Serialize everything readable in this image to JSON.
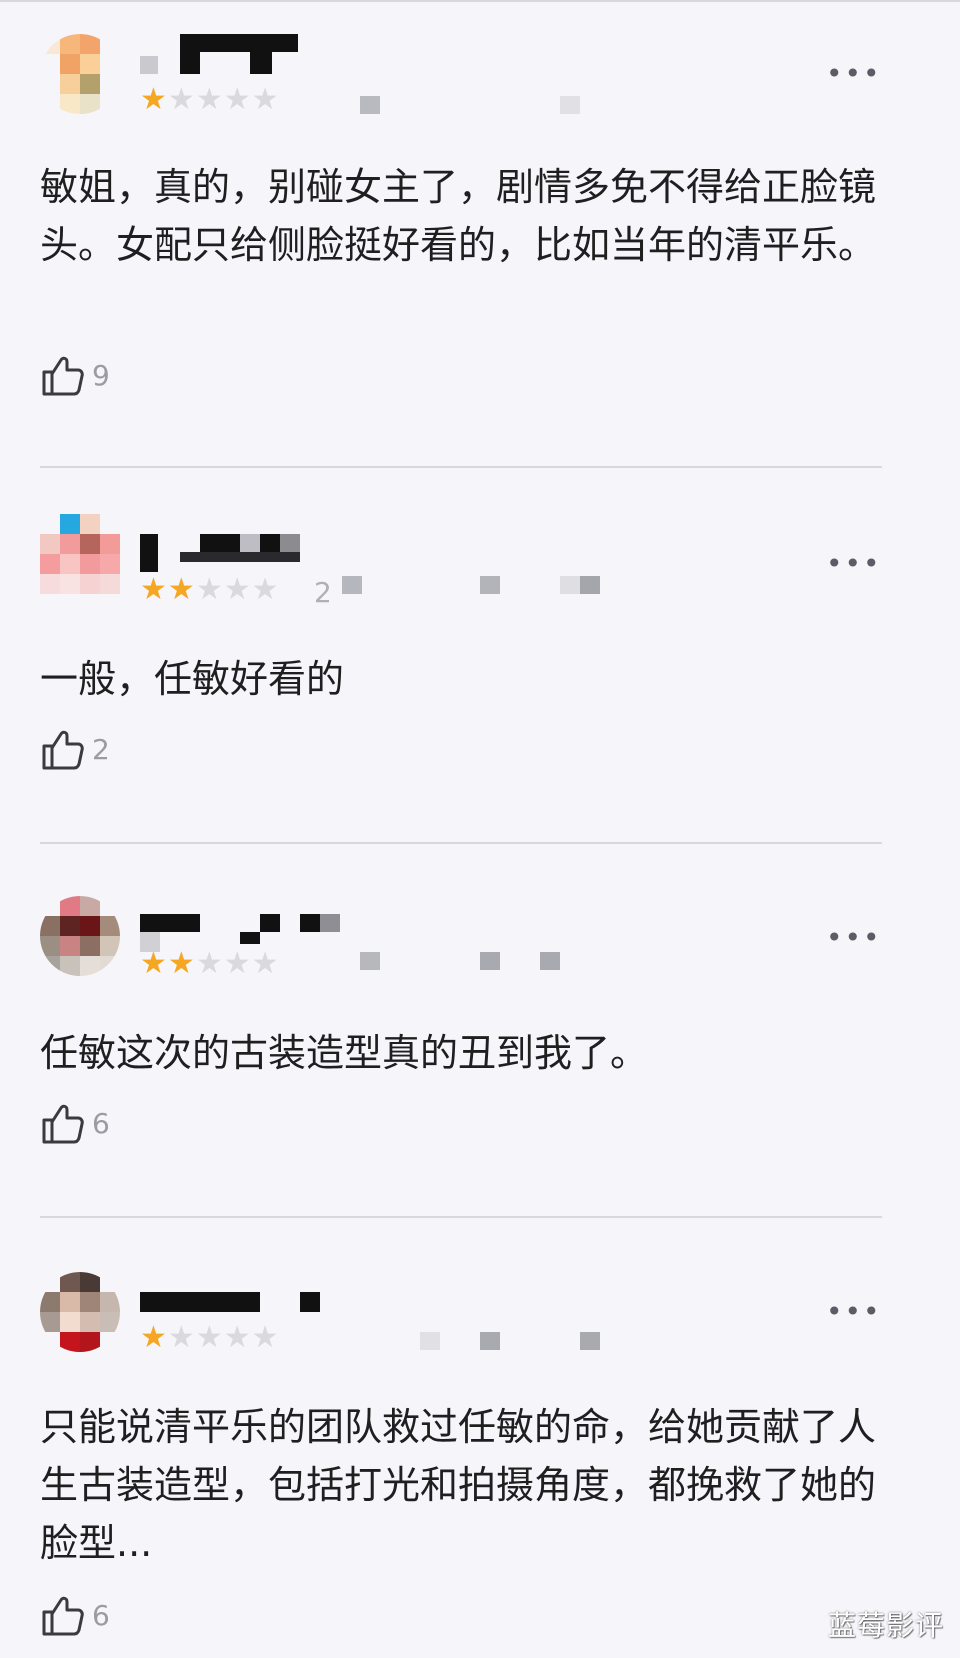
{
  "reviews": [
    {
      "rating": 1,
      "max_rating": 5,
      "stars_text": "★★★★★",
      "comment": "敏姐，真的，别碰女主了，剧情多免不得给正脸镜头。女配只给侧脸挺好看的，比如当年的清平乐。",
      "likes": "9",
      "more_label": "•••"
    },
    {
      "rating": 2,
      "max_rating": 5,
      "stars_text": "★★★★★",
      "date_fragment": "2",
      "comment": "一般，任敏好看的",
      "likes": "2",
      "more_label": "•••"
    },
    {
      "rating": 2,
      "max_rating": 5,
      "stars_text": "★★★★★",
      "comment": "任敏这次的古装造型真的丑到我了。",
      "likes": "6",
      "more_label": "•••"
    },
    {
      "rating": 1,
      "max_rating": 5,
      "stars_text": "★★★★★",
      "comment": "只能说清平乐的团队救过任敏的命，给她贡献了人生古装造型，包括打光和拍摄角度，都挽救了她的脸型...",
      "likes": "6",
      "more_label": "•••"
    }
  ],
  "colors": {
    "background": "#f6f5fa",
    "star_on": "#f5a623",
    "star_off": "#d9d9de",
    "divider": "#d9d8de",
    "like_icon": "#3a3a3f"
  },
  "icons": {
    "like": "thumbs-up-icon",
    "more": "more-dots-icon"
  },
  "watermark": "蓝莓影评"
}
